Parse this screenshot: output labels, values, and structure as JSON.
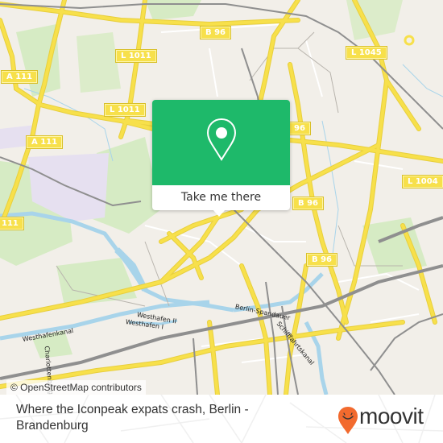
{
  "map": {
    "attribution": "© OpenStreetMap contributors",
    "road_labels": [
      {
        "id": "b96-top",
        "text": "B 96"
      },
      {
        "id": "l1011-top",
        "text": "L 1011"
      },
      {
        "id": "l1045",
        "text": "L 1045"
      },
      {
        "id": "a111-left",
        "text": "A 111"
      },
      {
        "id": "l1011-mid",
        "text": "L 1011"
      },
      {
        "id": "a111-mid",
        "text": "A 111"
      },
      {
        "id": "b96-right",
        "text": "96"
      },
      {
        "id": "l1004",
        "text": "L 1004"
      },
      {
        "id": "a111-bottom",
        "text": "111"
      },
      {
        "id": "b96-mid",
        "text": "B 96"
      },
      {
        "id": "b96-lower",
        "text": "B 96"
      }
    ],
    "water_labels": [
      {
        "id": "westhafenkanal",
        "text": "Westhafenkanal"
      },
      {
        "id": "westhafen-2",
        "text": "Westhafen II"
      },
      {
        "id": "westhafen-1",
        "text": "Westhafen I"
      },
      {
        "id": "charlottenburger",
        "text": "Charlottenburger"
      },
      {
        "id": "spandauer-1",
        "text": "Berlin-Spandauer"
      },
      {
        "id": "spandauer-2",
        "text": "Schifffahrtskanal"
      }
    ],
    "colors": {
      "land": "#f2efe9",
      "park": "#cde8b5",
      "water": "#a8d4ea",
      "road": "#f7e04b",
      "rail": "#8f8f8f",
      "special": "#e6e0f0"
    }
  },
  "callout": {
    "icon": "location-pin-icon",
    "button_label": "Take me there",
    "color": "#1eb96a"
  },
  "footer": {
    "title": "Where the Iconpeak expats crash, Berlin - Brandenburg",
    "brand": "moovit",
    "brand_icon": "moovit-smile-pin-icon",
    "brand_color": "#f26a2e"
  }
}
